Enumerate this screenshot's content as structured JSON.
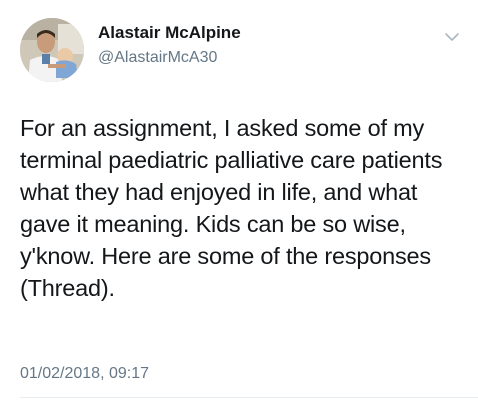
{
  "author": {
    "display_name": "Alastair McAlpine",
    "handle": "@AlastairMcA30"
  },
  "tweet": {
    "text": "For an assignment, I asked some of my terminal paediatric palliative care patients what they had enjoyed in life, and what gave it meaning. Kids can be so wise, y'know. Here are some of the responses (Thread).",
    "timestamp": "01/02/2018, 09:17"
  },
  "icons": {
    "menu": "chevron-down-icon",
    "avatar": "profile-photo"
  },
  "colors": {
    "text_primary": "#14171a",
    "text_secondary": "#657786",
    "divider": "#e6ecf0"
  }
}
